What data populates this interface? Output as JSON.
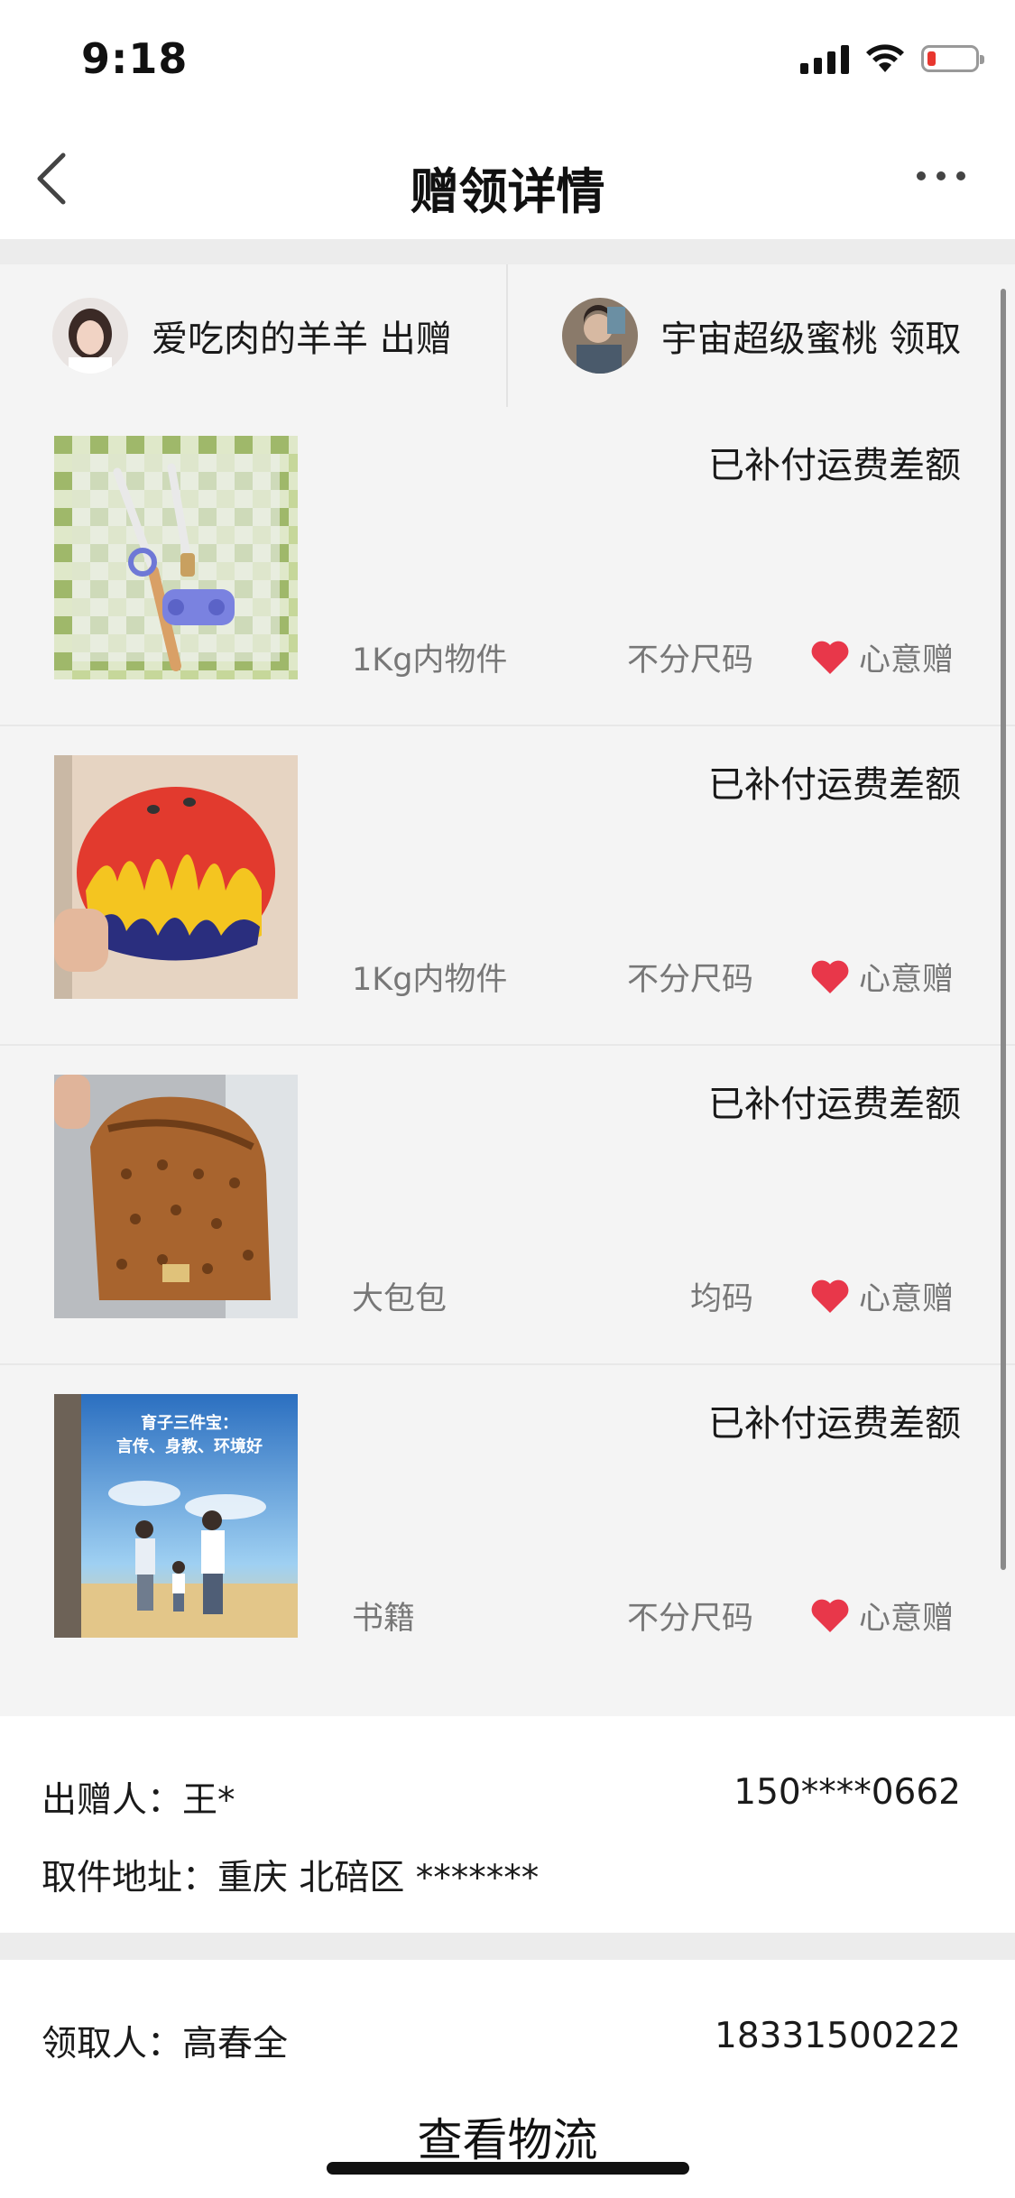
{
  "status_bar": {
    "time": "9:18"
  },
  "nav": {
    "title": "赠领详情"
  },
  "parties": {
    "giver": {
      "label": "爱吃肉的羊羊 出赠"
    },
    "receiver": {
      "label": "宇宙超级蜜桃 领取"
    }
  },
  "items": [
    {
      "status": "已补付运费差额",
      "weight": "1Kg内物件",
      "size": "不分尺码",
      "gift": "心意赠",
      "photo": "chopsticks"
    },
    {
      "status": "已补付运费差额",
      "weight": "1Kg内物件",
      "size": "不分尺码",
      "gift": "心意赠",
      "photo": "helmet"
    },
    {
      "status": "已补付运费差额",
      "weight": "大包包",
      "size": "均码",
      "gift": "心意赠",
      "photo": "backpack"
    },
    {
      "status": "已补付运费差额",
      "weight": "书籍",
      "size": "不分尺码",
      "gift": "心意赠",
      "photo": "book"
    }
  ],
  "book_cover": {
    "line1": "育子三件宝：",
    "line2": "言传、身教、环境好"
  },
  "sender": {
    "name_label": "出赠人：王*",
    "phone": "150****0662",
    "address_label": "取件地址：重庆 北碚区 *******"
  },
  "receiver": {
    "name_label": "领取人：高春全",
    "phone": "18331500222"
  },
  "actions": {
    "logistics": "查看物流"
  },
  "colors": {
    "heart": "#e8374a",
    "status_bar_battery": "#e8372f",
    "panel_bg": "#f4f4f4"
  }
}
